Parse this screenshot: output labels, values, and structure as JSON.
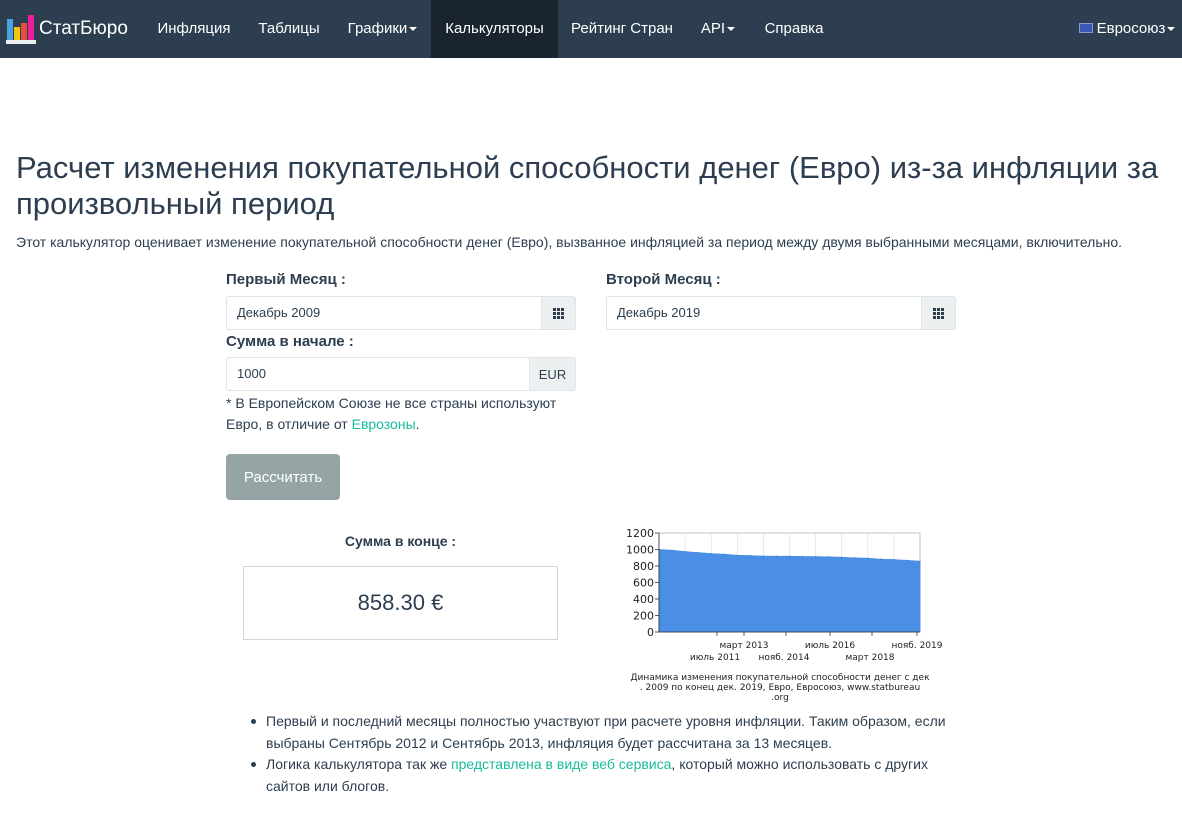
{
  "navbar": {
    "brand": "СтатБюро",
    "items": [
      {
        "label": "Инфляция"
      },
      {
        "label": "Таблицы"
      },
      {
        "label": "Графики"
      },
      {
        "label": "Калькуляторы"
      },
      {
        "label": "Рейтинг Стран"
      },
      {
        "label": "API"
      },
      {
        "label": "Справка"
      }
    ],
    "region": "Евросоюз"
  },
  "page": {
    "title": "Расчет изменения покупательной способности денег (Евро) из-за инфляции за произвольный период",
    "intro": "Этот калькулятор оценивает изменение покупательной способности денег (Евро), вызванное инфляцией за период между двумя выбранными месяцами, включительно."
  },
  "form": {
    "first_month_label": "Первый Месяц :",
    "first_month_value": "Декабрь 2009",
    "second_month_label": "Второй Месяц :",
    "second_month_value": "Декабрь 2019",
    "amount_label": "Сумма в начале :",
    "amount_value": "1000",
    "currency": "EUR",
    "note_text": "* В Европейском Союзе не все страны используют Евро, в отличие от",
    "note_link": "Еврозоны",
    "note_end": ".",
    "calculate_label": "Рассчитать"
  },
  "result": {
    "label": "Сумма в конце :",
    "value": "858.30 €"
  },
  "chart_data": {
    "type": "area",
    "title": "Динамика изменения покупательной способности денег с дек. 2009 по конец дек. 2019, Евро, Евросоюз, www.statbureau.org",
    "title_lines": [
      "Динамика изменения покупательной способности денег с дек",
      ". 2009 по конец дек. 2019, Евро, Евросоюз, www.statbureau",
      ".org"
    ],
    "ylim": [
      0,
      1200
    ],
    "y_ticks": [
      "0",
      "200",
      "400",
      "600",
      "800",
      "1000",
      "1200"
    ],
    "x_tick_labels_top": [
      "март 2013",
      "июль 2016",
      "нояб. 2019"
    ],
    "x_tick_labels_bottom": [
      "июль 2011",
      "нояб. 2014",
      "март 2018"
    ],
    "x": [
      "2009-12",
      "2010-06",
      "2010-12",
      "2011-06",
      "2011-12",
      "2012-06",
      "2012-12",
      "2013-06",
      "2013-12",
      "2014-06",
      "2014-12",
      "2015-06",
      "2015-12",
      "2016-06",
      "2016-12",
      "2017-06",
      "2017-12",
      "2018-06",
      "2018-12",
      "2019-06",
      "2019-12"
    ],
    "values": [
      1000,
      990,
      975,
      963,
      950,
      942,
      930,
      925,
      920,
      918,
      918,
      915,
      913,
      910,
      905,
      898,
      893,
      883,
      878,
      868,
      858
    ],
    "color": "#4a8ee6"
  },
  "bullets": {
    "item1": "Первый и последний месяцы полностью участвуют при расчете уровня инфляции. Таким образом, если выбраны Сентябрь 2012 и Сентябрь 2013, инфляция будет рассчитана за 13 месяцев.",
    "item2_pre": "Логика калькулятора так же",
    "item2_link": "представлена в виде веб сервиса",
    "item2_post": ", который можно использовать с других сайтов или блогов."
  }
}
